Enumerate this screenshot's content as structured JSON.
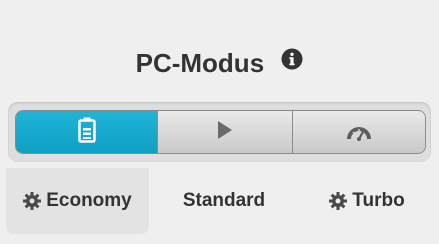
{
  "header": {
    "title": "PC-Modus",
    "info_icon": "info-circle-icon"
  },
  "mode_selector": {
    "buttons": [
      {
        "icon": "battery-icon",
        "active": true
      },
      {
        "icon": "play-icon",
        "active": false
      },
      {
        "icon": "speedometer-icon",
        "active": false
      }
    ],
    "labels": [
      {
        "text": "Economy",
        "icon": "gear-icon",
        "selected": true
      },
      {
        "text": "Standard",
        "icon": "",
        "selected": false
      },
      {
        "text": "Turbo",
        "icon": "gear-icon",
        "selected": false
      }
    ]
  },
  "colors": {
    "accent": "#0fa0c4",
    "text": "#333333",
    "background": "#efefef"
  }
}
